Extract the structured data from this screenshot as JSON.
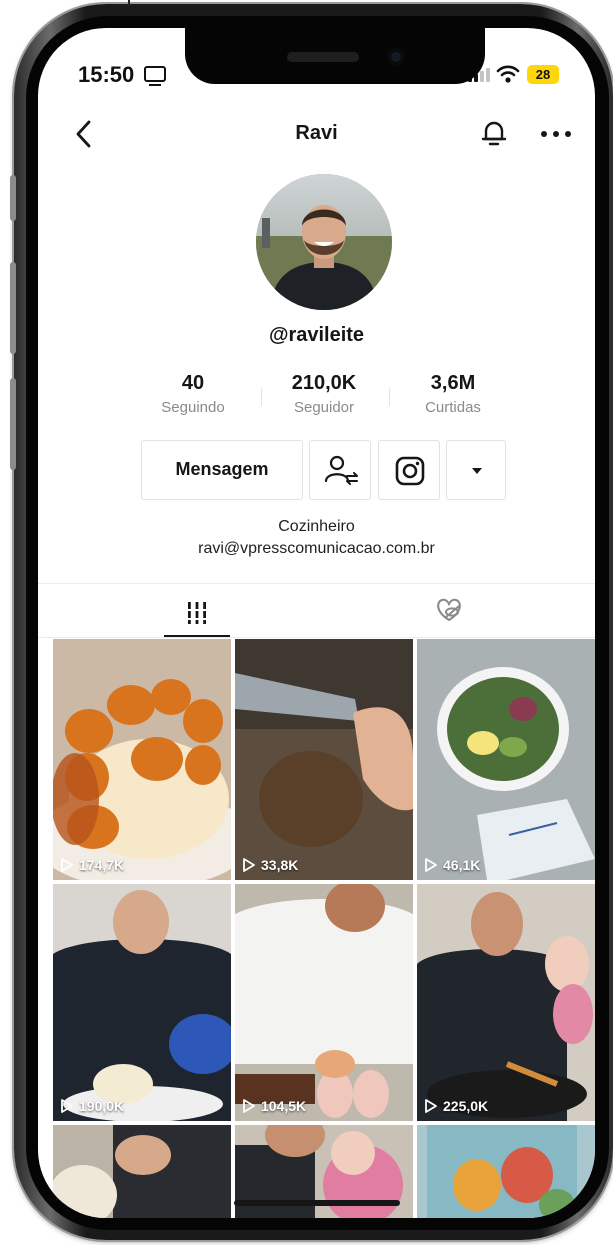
{
  "status_bar": {
    "time": "15:50",
    "battery": "28"
  },
  "header": {
    "title": "Ravi",
    "icons": [
      "back-icon",
      "bell-icon",
      "more-options-icon"
    ]
  },
  "profile": {
    "username": "@ravileite",
    "stats": [
      {
        "value": "40",
        "label": "Seguindo"
      },
      {
        "value": "210,0K",
        "label": "Seguidor"
      },
      {
        "value": "3,6M",
        "label": "Curtidas"
      }
    ],
    "buttons": {
      "message": "Mensagem"
    },
    "bio_line1": "Cozinheiro",
    "bio_line2": "ravi@vpresscomunicacao.com.br"
  },
  "tabs": [
    {
      "icon": "grid-icon",
      "active": true
    },
    {
      "icon": "liked-heart-hidden-icon",
      "active": false
    }
  ],
  "videos": [
    {
      "views": "174,7K"
    },
    {
      "views": "33,8K"
    },
    {
      "views": "46,1K"
    },
    {
      "views": "190,0K"
    },
    {
      "views": "104,5K"
    },
    {
      "views": "225,0K"
    },
    {
      "views": ""
    },
    {
      "views": ""
    },
    {
      "views": ""
    }
  ],
  "colors": {
    "battery": "#ffd60a",
    "text": "#161616",
    "muted": "#8a8a8a"
  }
}
